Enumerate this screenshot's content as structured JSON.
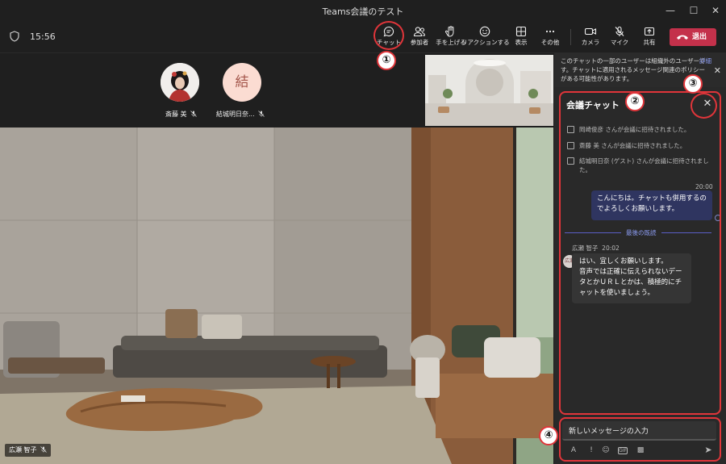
{
  "window": {
    "title": "Teams会議のテスト"
  },
  "toolbar": {
    "time": "15:56",
    "buttons": [
      {
        "label": "チャット",
        "icon": "chat-icon"
      },
      {
        "label": "参加者",
        "icon": "people-icon"
      },
      {
        "label": "手を上げる",
        "icon": "raise-hand-icon"
      },
      {
        "label": "リアクションする",
        "icon": "reaction-icon"
      },
      {
        "label": "表示",
        "icon": "view-icon"
      },
      {
        "label": "その他",
        "icon": "more-icon"
      },
      {
        "label": "カメラ",
        "icon": "camera-icon"
      },
      {
        "label": "マイク",
        "icon": "mic-off-icon"
      },
      {
        "label": "共有",
        "icon": "share-icon"
      }
    ],
    "leave_label": "退出"
  },
  "participants": [
    {
      "name": "斎藤 美",
      "initial": ""
    },
    {
      "name": "結城明日奈...",
      "initial": "結"
    }
  ],
  "main_video": {
    "name": "広瀬 智子"
  },
  "banner": {
    "text": "このチャットの一部のユーザーは組織外のユーザーです。チャットに適用されるメッセージ関連のポリシーがある可能性があります。",
    "link": "詳細"
  },
  "chat": {
    "title": "会議チャット",
    "system_messages": [
      "岡崎俊彦 さんが会議に招待されました。",
      "斎藤 美 さんが会議に招待されました。",
      "結城明日奈 (ゲスト) さんが会議に招待されました。"
    ],
    "my_time": "20:00",
    "my_message": "こんにちは。チャットも併用するのでよろしくお願いします。",
    "last_read_label": "最後の既読",
    "other_sender": "広瀬 智子",
    "other_time": "20:02",
    "other_avatar": "広瀬",
    "other_message": "はい、宜しくお願いします。\n音声では正確に伝えられないデータとかＵＲＬとかは、積極的にチャットを使いましょう。",
    "compose_placeholder": "新しいメッセージの入力"
  },
  "annotations": [
    "①",
    "②",
    "③",
    "④"
  ],
  "colors": {
    "leave": "#c4314b",
    "annotation": "#e0353a",
    "accent": "#5b5fc7"
  }
}
